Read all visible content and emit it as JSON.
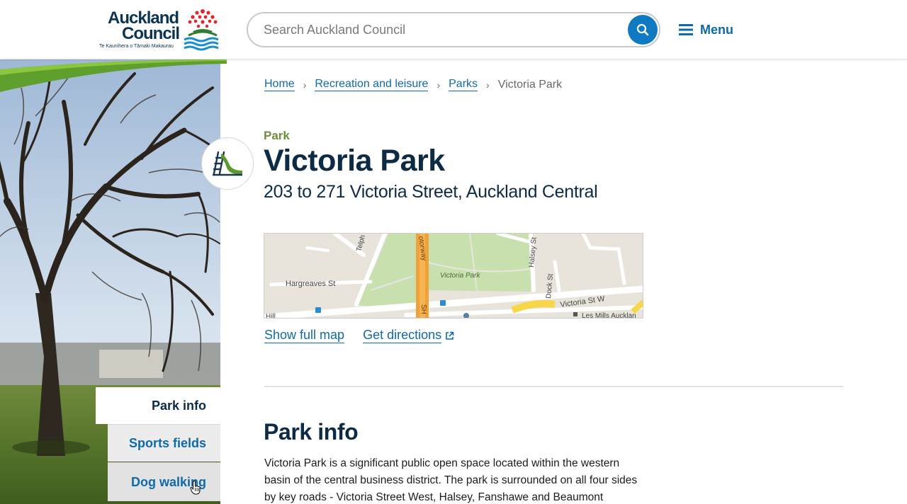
{
  "header": {
    "logo": {
      "line1": "Auckland",
      "line2": "Council",
      "tagline": "Te Kaunihera o Tāmaki Makaurau"
    },
    "search": {
      "placeholder": "Search Auckland Council",
      "icon": "search-icon"
    },
    "menu": {
      "label": "Menu",
      "icon": "hamburger-icon"
    }
  },
  "side_tabs": [
    {
      "label": "Park info",
      "active": true
    },
    {
      "label": "Sports fields",
      "active": false
    },
    {
      "label": "Dog walking",
      "active": false
    }
  ],
  "breadcrumb": [
    {
      "label": "Home",
      "link": true
    },
    {
      "label": "Recreation and leisure",
      "link": true
    },
    {
      "label": "Parks",
      "link": true
    },
    {
      "label": "Victoria Park",
      "link": false
    }
  ],
  "page": {
    "type": "Park",
    "title": "Victoria Park",
    "address": "203 to 271 Victoria Street, Auckland Central"
  },
  "map": {
    "labels": {
      "park": "Victoria Park",
      "hargreaves": "Hargreaves St",
      "victoria_st_w": "Victoria St W",
      "halsey": "Halsey St",
      "dock": "Dock St",
      "telph": "Telph",
      "motorway": "otorway",
      "sh": "SH",
      "hill": "Hill",
      "les_mills": "Les Mills Aucklan"
    },
    "links": {
      "show_full_map": "Show full map",
      "get_directions": "Get directions"
    }
  },
  "content": {
    "section_title": "Park info",
    "paragraph": "Victoria Park is a significant public open space located within the western basin of the central business district. The park is surrounded on all four sides by key roads - Victoria Street West, Halsey, Fanshawe and Beaumont"
  },
  "colors": {
    "brand_navy": "#0d2b45",
    "link_blue": "#0f6aa8",
    "park_green": "#6f8e3a",
    "search_button": "#0f7ac1"
  }
}
